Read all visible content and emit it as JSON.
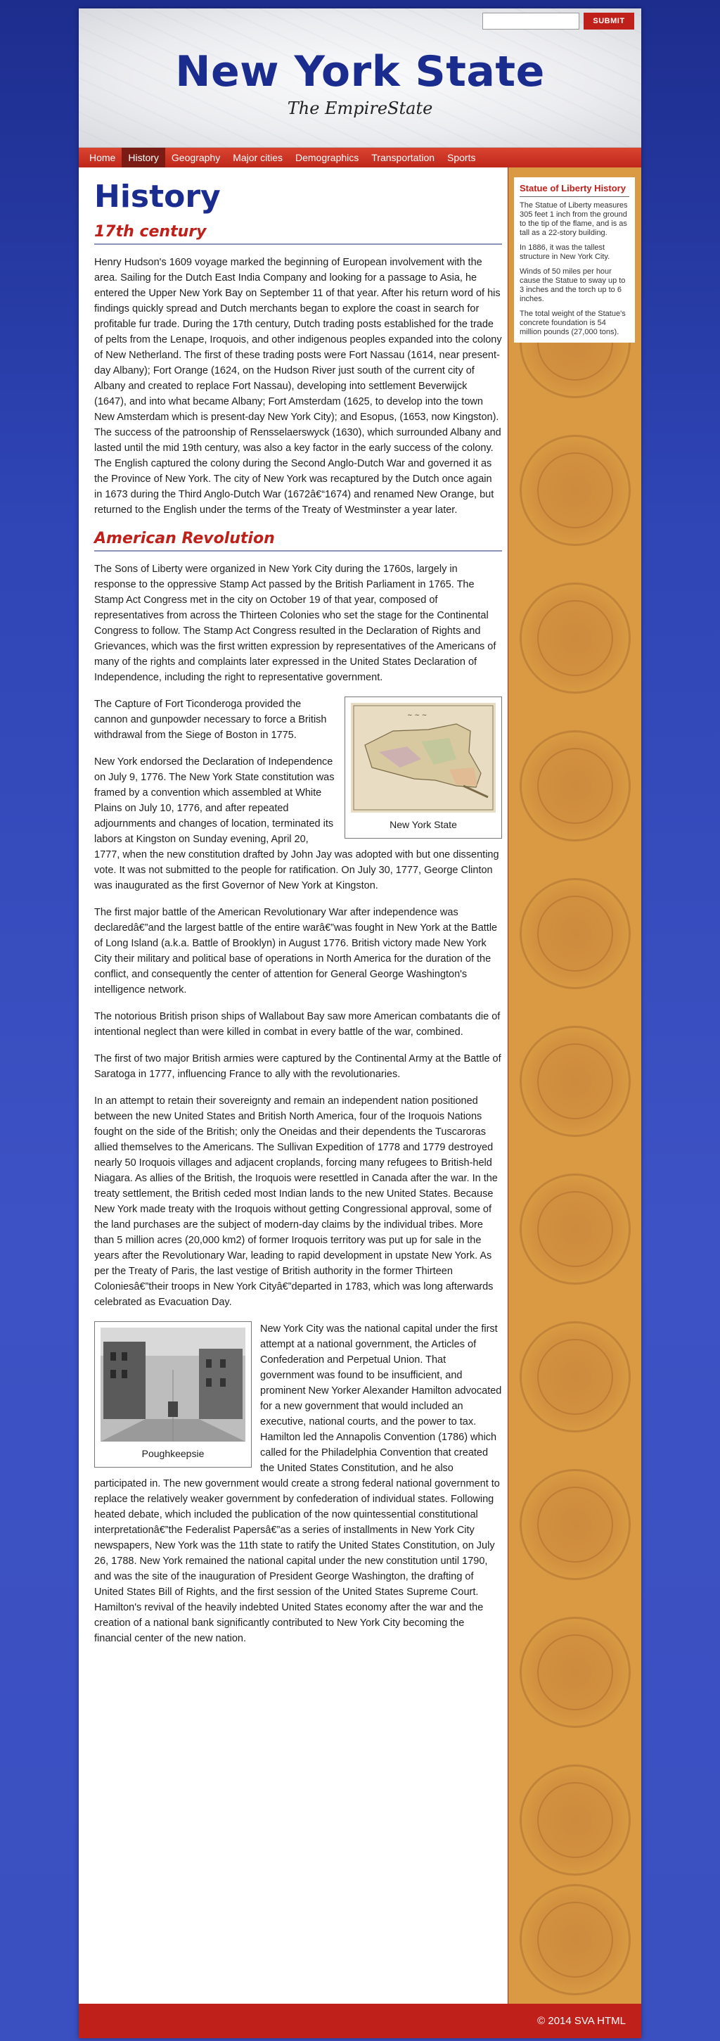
{
  "header": {
    "title": "New York State",
    "tagline": "The EmpireState",
    "search": {
      "placeholder": "",
      "value": "",
      "submit_label": "SUBMIT"
    }
  },
  "nav": {
    "items": [
      "Home",
      "History",
      "Geography",
      "Major cities",
      "Demographics",
      "Transportation",
      "Sports"
    ],
    "active": "History"
  },
  "main": {
    "title": "History",
    "sections": [
      {
        "heading": "17th century",
        "paragraphs": [
          "Henry Hudson's 1609 voyage marked the beginning of European involvement with the area. Sailing for the Dutch East India Company and looking for a passage to Asia, he entered the Upper New York Bay on September 11 of that year. After his return word of his findings quickly spread and Dutch merchants began to explore the coast in search for profitable fur trade. During the 17th century, Dutch trading posts established for the trade of pelts from the Lenape, Iroquois, and other indigenous peoples expanded into the colony of New Netherland. The first of these trading posts were Fort Nassau (1614, near present-day Albany); Fort Orange (1624, on the Hudson River just south of the current city of Albany and created to replace Fort Nassau), developing into settlement Beverwijck (1647), and into what became Albany; Fort Amsterdam (1625, to develop into the town New Amsterdam which is present-day New York City); and Esopus, (1653, now Kingston). The success of the patroonship of Rensselaerswyck (1630), which surrounded Albany and lasted until the mid 19th century, was also a key factor in the early success of the colony. The English captured the colony during the Second Anglo-Dutch War and governed it as the Province of New York. The city of New York was recaptured by the Dutch once again in 1673 during the Third Anglo-Dutch War (1672â€“1674) and renamed New Orange, but returned to the English under the terms of the Treaty of Westminster a year later."
        ]
      },
      {
        "heading": "American Revolution",
        "paragraphs": [
          "The Sons of Liberty were organized in New York City during the 1760s, largely in response to the oppressive Stamp Act passed by the British Parliament in 1765. The Stamp Act Congress met in the city on October 19 of that year, composed of representatives from across the Thirteen Colonies who set the stage for the Continental Congress to follow. The Stamp Act Congress resulted in the Declaration of Rights and Grievances, which was the first written expression by representatives of the Americans of many of the rights and complaints later expressed in the United States Declaration of Independence, including the right to representative government.",
          "The Capture of Fort Ticonderoga provided the cannon and gunpowder necessary to force a British withdrawal from the Siege of Boston in 1775.",
          "New York endorsed the Declaration of Independence on July 9, 1776. The New York State constitution was framed by a convention which assembled at White Plains on July 10, 1776, and after repeated adjournments and changes of location, terminated its labors at Kingston on Sunday evening, April 20, 1777, when the new constitution drafted by John Jay was adopted with but one dissenting vote. It was not submitted to the people for ratification. On July 30, 1777, George Clinton was inaugurated as the first Governor of New York at Kingston.",
          "The first major battle of the American Revolutionary War after independence was declaredâ€”and the largest battle of the entire warâ€”was fought in New York at the Battle of Long Island (a.k.a. Battle of Brooklyn) in August 1776. British victory made New York City their military and political base of operations in North America for the duration of the conflict, and consequently the center of attention for General George Washington's intelligence network.",
          "The notorious British prison ships of Wallabout Bay saw more American combatants die of intentional neglect than were killed in combat in every battle of the war, combined.",
          "The first of two major British armies were captured by the Continental Army at the Battle of Saratoga in 1777, influencing France to ally with the revolutionaries.",
          "In an attempt to retain their sovereignty and remain an independent nation positioned between the new United States and British North America, four of the Iroquois Nations fought on the side of the British; only the Oneidas and their dependents the Tuscaroras allied themselves to the Americans. The Sullivan Expedition of 1778 and 1779 destroyed nearly 50 Iroquois villages and adjacent croplands, forcing many refugees to British-held Niagara. As allies of the British, the Iroquois were resettled in Canada after the war. In the treaty settlement, the British ceded most Indian lands to the new United States. Because New York made treaty with the Iroquois without getting Congressional approval, some of the land purchases are the subject of modern-day claims by the individual tribes. More than 5 million acres (20,000 km2) of former Iroquois territory was put up for sale in the years after the Revolutionary War, leading to rapid development in upstate New York. As per the Treaty of Paris, the last vestige of British authority in the former Thirteen Coloniesâ€”their troops in New York Cityâ€”departed in 1783, which was long afterwards celebrated as Evacuation Day.",
          "New York City was the national capital under the first attempt at a national government, the Articles of Confederation and Perpetual Union. That government was found to be insufficient, and prominent New Yorker Alexander Hamilton advocated for a new government that would included an executive, national courts, and the power to tax. Hamilton led the Annapolis Convention (1786) which called for the Philadelphia Convention that created the United States Constitution, and he also participated in. The new government would create a strong federal national government to replace the relatively weaker government by confederation of individual states. Following heated debate, which included the publication of the now quintessential constitutional interpretationâ€”the Federalist Papersâ€”as a series of installments in New York City newspapers, New York was the 11th state to ratify the United States Constitution, on July 26, 1788. New York remained the national capital under the new constitution until 1790, and was the site of the inauguration of President George Washington, the drafting of United States Bill of Rights, and the first session of the United States Supreme Court. Hamilton's revival of the heavily indebted United States economy after the war and the creation of a national bank significantly contributed to New York City becoming the financial center of the new nation."
        ],
        "figures": [
          {
            "caption": "New York State"
          },
          {
            "caption": "Poughkeepsie"
          }
        ]
      }
    ]
  },
  "sidebar": {
    "title": "Statue of Liberty History",
    "paragraphs": [
      "The Statue of Liberty measures 305 feet 1 inch from the ground to the tip of the flame, and is as tall as a 22-story building.",
      "In 1886, it was the tallest structure in New York City.",
      "Winds of 50 miles per hour cause the Statue to sway up to 3 inches and the torch up to 6 inches.",
      "The total weight of the Statue's concrete foundation is 54 million pounds (27,000 tons)."
    ]
  },
  "footer": {
    "text": "© 2014 SVA HTML"
  },
  "colors": {
    "accent_red": "#c0201a",
    "title_blue": "#1a2c8e",
    "sidebar_tan": "#d99a43"
  }
}
